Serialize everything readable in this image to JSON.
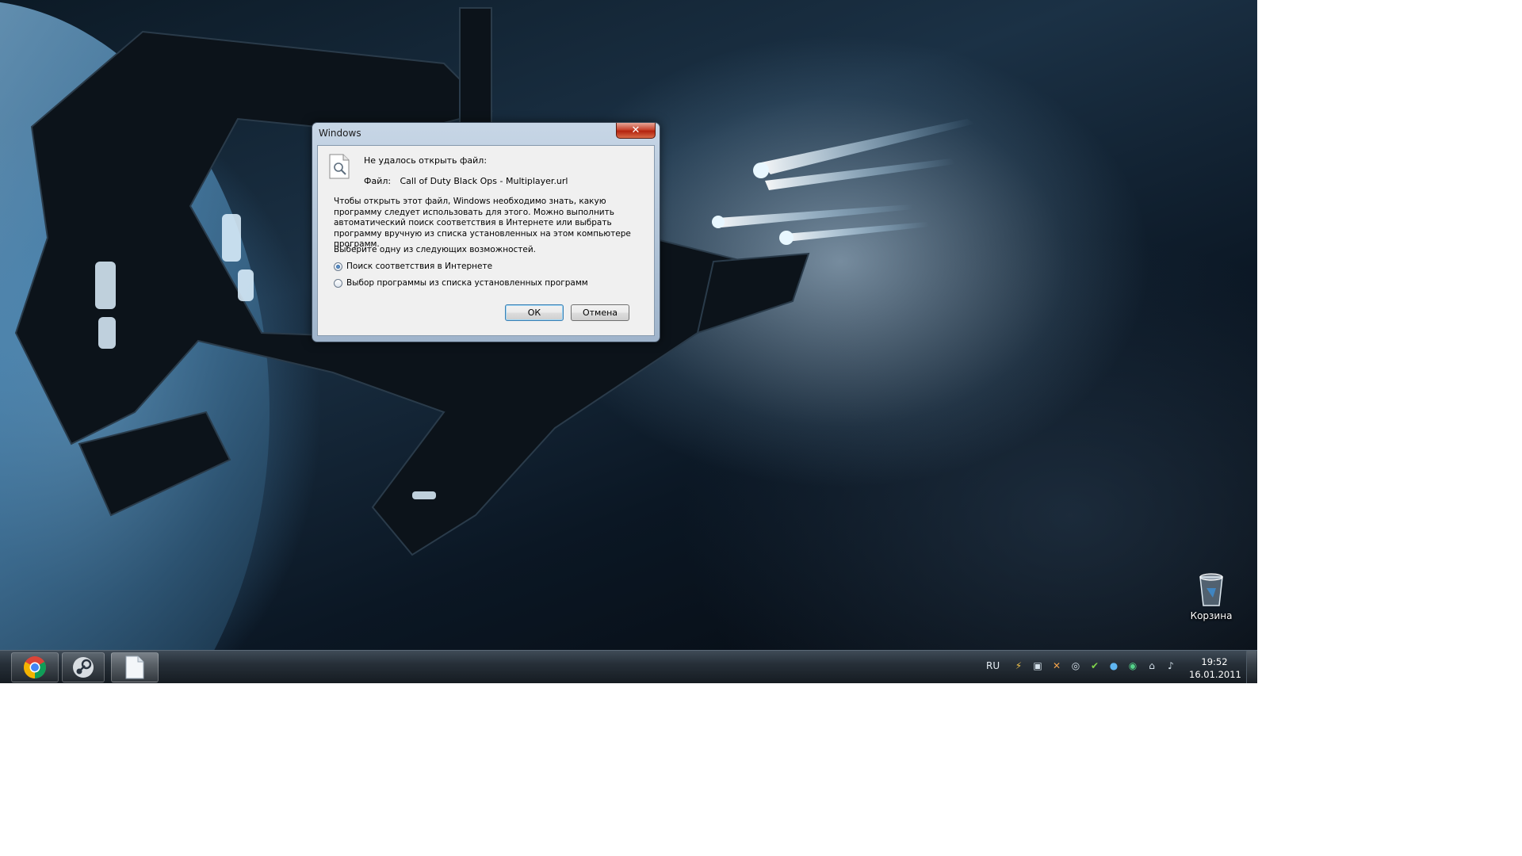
{
  "dialog": {
    "title": "Windows",
    "close_label": "✕",
    "heading": "Не удалось открыть файл:",
    "file_label": "Файл:",
    "file_name": "Call of Duty Black Ops - Multiplayer.url",
    "description": "Чтобы открыть этот файл, Windows необходимо знать, какую программу следует использовать для этого. Можно выполнить автоматический поиск соответствия в Интернете или выбрать программу вручную из списка установленных на этом компьютере программ.",
    "choose_prompt": "Выберите одну из следующих возможностей.",
    "options": [
      {
        "label": "Поиск соответствия в Интернете",
        "checked": true
      },
      {
        "label": "Выбор программы из списка установленных программ",
        "checked": false
      }
    ],
    "ok_label": "ОК",
    "cancel_label": "Отмена"
  },
  "desktop": {
    "recycle_bin_label": "Корзина",
    "recycle_bin_icon": "recycle-bin-icon"
  },
  "taskbar": {
    "pinned": [
      {
        "name": "chrome",
        "icon": "chrome-icon"
      },
      {
        "name": "steam",
        "icon": "steam-icon"
      },
      {
        "name": "file",
        "icon": "document-icon"
      }
    ],
    "language": "RU",
    "tray_icons": [
      "lightning-icon",
      "printer-icon",
      "x-icon",
      "steam-tray-icon",
      "shield-green-icon",
      "bolt-icon",
      "green-icon",
      "network-icon",
      "speaker-icon"
    ],
    "time": "19:52",
    "date": "16.01.2011"
  },
  "colors": {
    "close_button": "#c8452f",
    "ok_focus": "#3c7fb1",
    "taskbar": "#262f38"
  }
}
